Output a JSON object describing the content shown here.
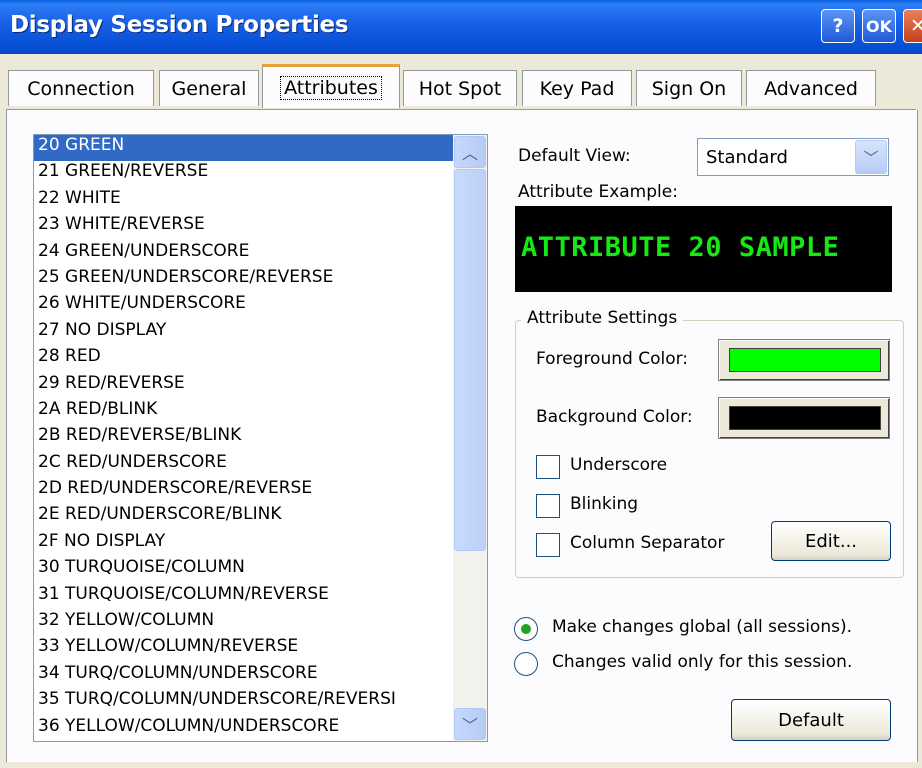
{
  "window": {
    "title": "Display Session Properties",
    "help_label": "?",
    "ok_label": "OK",
    "close_label": "✕"
  },
  "tabs": [
    {
      "label": "Connection"
    },
    {
      "label": "General"
    },
    {
      "label": "Attributes",
      "active": true
    },
    {
      "label": "Hot Spot"
    },
    {
      "label": "Key Pad"
    },
    {
      "label": "Sign On"
    },
    {
      "label": "Advanced"
    }
  ],
  "attributes_list": {
    "selected_index": 0,
    "items": [
      "20 GREEN",
      "21 GREEN/REVERSE",
      "22 WHITE",
      "23 WHITE/REVERSE",
      "24 GREEN/UNDERSCORE",
      "25 GREEN/UNDERSCORE/REVERSE",
      "26 WHITE/UNDERSCORE",
      "27 NO DISPLAY",
      "28 RED",
      "29 RED/REVERSE",
      "2A RED/BLINK",
      "2B RED/REVERSE/BLINK",
      "2C RED/UNDERSCORE",
      "2D RED/UNDERSCORE/REVERSE",
      "2E RED/UNDERSCORE/BLINK",
      "2F NO DISPLAY",
      "30 TURQUOISE/COLUMN",
      "31 TURQUOISE/COLUMN/REVERSE",
      "32 YELLOW/COLUMN",
      "33 YELLOW/COLUMN/REVERSE",
      "34 TURQ/COLUMN/UNDERSCORE",
      "35 TURQ/COLUMN/UNDERSCORE/REVERSI",
      "36 YELLOW/COLUMN/UNDERSCORE"
    ]
  },
  "view": {
    "default_view_label": "Default View:",
    "default_view_value": "Standard",
    "example_label": "Attribute Example:",
    "example_text": "ATTRIBUTE 20 SAMPLE",
    "example_fg": "#16e816",
    "example_bg": "#000000"
  },
  "settings": {
    "group_title": "Attribute Settings",
    "foreground_label": "Foreground Color:",
    "foreground_color": "#00ff00",
    "background_label": "Background Color:",
    "background_color": "#000000",
    "underscore_label": "Underscore",
    "underscore_checked": false,
    "blinking_label": "Blinking",
    "blinking_checked": false,
    "column_separator_label": "Column Separator",
    "column_separator_checked": false,
    "edit_label": "Edit..."
  },
  "scope": {
    "global_label": "Make changes global (all sessions).",
    "session_label": "Changes valid only for this session.",
    "selected": "global"
  },
  "default_button_label": "Default"
}
